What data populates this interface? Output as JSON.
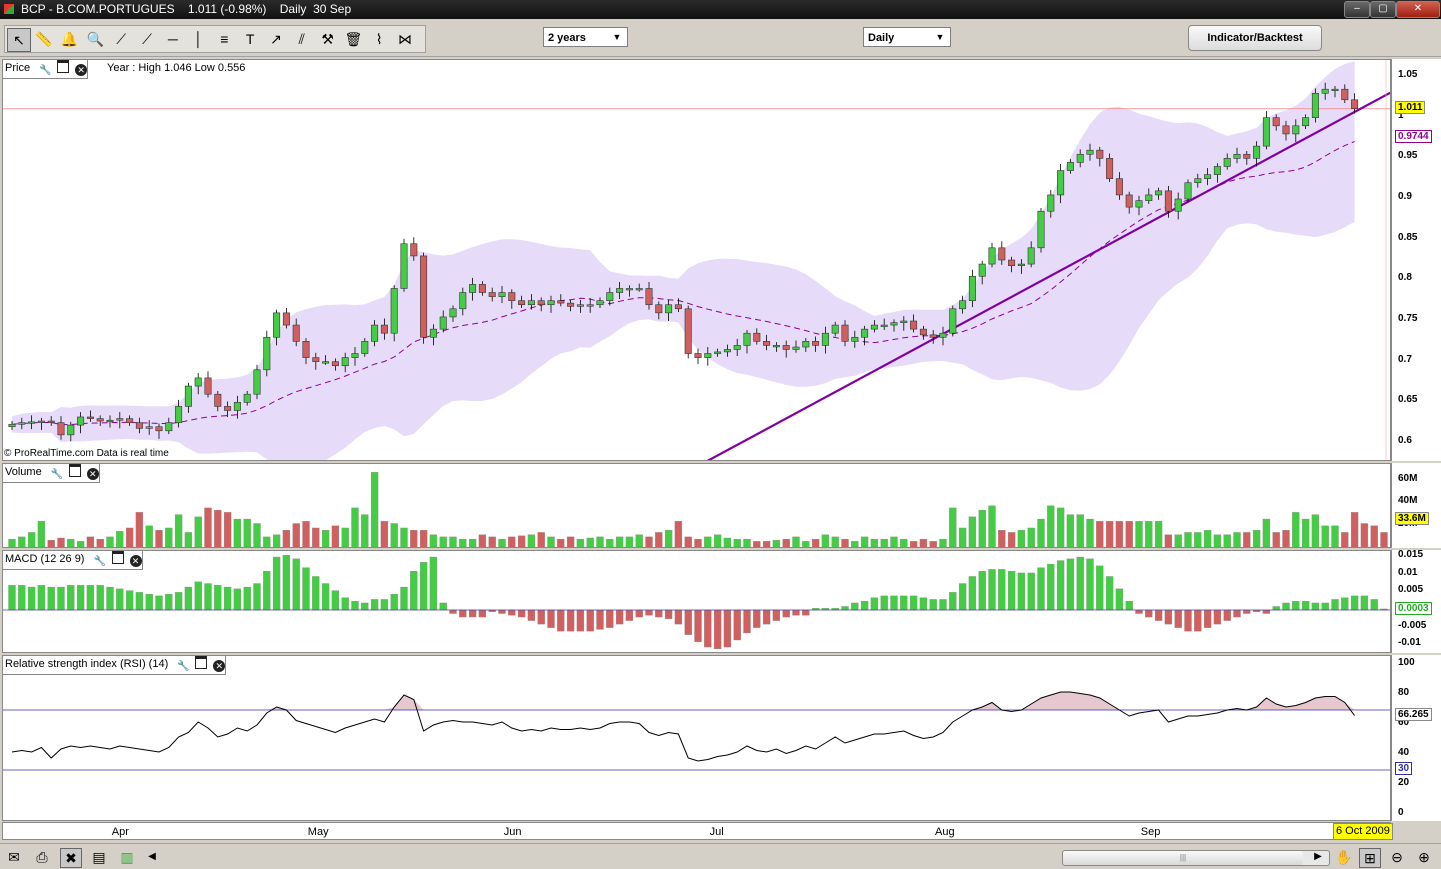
{
  "window": {
    "title": "BCP - B.COM.PORTUGUES    1.011 (-0.98%)    Daily  30 Sep",
    "minimize_label": "–",
    "maximize_label": "▢",
    "close_label": "✕"
  },
  "toolbar": {
    "tools": [
      "pointer-icon",
      "ruler-icon",
      "alert-bell-icon",
      "zoom-icon",
      "trendline-icon",
      "line-icon",
      "horizontal-line-icon",
      "vertical-line-icon",
      "fibonacci-icon",
      "text-icon",
      "arrow-icon",
      "channel-icon",
      "tools-icon",
      "trash-icon",
      "indicator-icon",
      "pattern-icon"
    ],
    "period_select": "2 years",
    "interval_select": "Daily",
    "indicator_button": "Indicator/Backtest"
  },
  "price_panel": {
    "title": "Price",
    "year_info": "Year : High 1.046 Low 0.556",
    "copyright": "© ProRealTime.com  Data is real time",
    "ticks": [
      "1.05",
      "1",
      "0.95",
      "0.9",
      "0.85",
      "0.8",
      "0.75",
      "0.7",
      "0.65",
      "0.6"
    ],
    "last_price_badge": "1.011",
    "ma_badge": "0.9744"
  },
  "volume_panel": {
    "title": "Volume",
    "ticks": [
      "60M",
      "40M",
      "20M"
    ],
    "badge": "33.6M"
  },
  "macd_panel": {
    "title": "MACD (12 26 9)",
    "ticks": [
      "0.015",
      "0.01",
      "0.005",
      "0",
      "-0.005",
      "-0.01"
    ],
    "badge": "0.0003"
  },
  "rsi_panel": {
    "title": "Relative strength index (RSI) (14)",
    "ticks": [
      "100",
      "80",
      "60",
      "40",
      "20",
      "0"
    ],
    "badge_value": "66.265",
    "badge_level": "30"
  },
  "x_axis": {
    "labels": [
      "Apr",
      "May",
      "Jun",
      "Jul",
      "Aug",
      "Sep"
    ],
    "date_badge": "6 Oct 2009"
  },
  "colors": {
    "up": "#44cc44",
    "down": "#d06060",
    "band": "#e6dcfa",
    "ma": "#900090",
    "trendline": "#8000a0"
  },
  "chart_data": {
    "type": "candlestick",
    "price_ylim": [
      0.58,
      1.06
    ],
    "close": [
      0.623,
      0.625,
      0.626,
      0.627,
      0.625,
      0.61,
      0.622,
      0.632,
      0.63,
      0.627,
      0.628,
      0.63,
      0.625,
      0.618,
      0.62,
      0.615,
      0.625,
      0.645,
      0.67,
      0.68,
      0.66,
      0.645,
      0.64,
      0.65,
      0.66,
      0.69,
      0.73,
      0.76,
      0.745,
      0.725,
      0.705,
      0.7,
      0.7,
      0.695,
      0.705,
      0.71,
      0.725,
      0.745,
      0.735,
      0.79,
      0.845,
      0.83,
      0.73,
      0.74,
      0.755,
      0.765,
      0.785,
      0.795,
      0.785,
      0.78,
      0.785,
      0.775,
      0.77,
      0.775,
      0.77,
      0.775,
      0.772,
      0.768,
      0.77,
      0.77,
      0.775,
      0.785,
      0.79,
      0.79,
      0.79,
      0.77,
      0.76,
      0.77,
      0.765,
      0.71,
      0.705,
      0.71,
      0.712,
      0.715,
      0.72,
      0.735,
      0.725,
      0.72,
      0.72,
      0.715,
      0.718,
      0.725,
      0.72,
      0.735,
      0.745,
      0.725,
      0.73,
      0.74,
      0.745,
      0.745,
      0.748,
      0.75,
      0.74,
      0.733,
      0.73,
      0.735,
      0.765,
      0.775,
      0.805,
      0.82,
      0.84,
      0.825,
      0.818,
      0.82,
      0.84,
      0.885,
      0.905,
      0.935,
      0.945,
      0.955,
      0.96,
      0.95,
      0.925,
      0.905,
      0.89,
      0.898,
      0.905,
      0.91,
      0.885,
      0.9,
      0.92,
      0.925,
      0.93,
      0.94,
      0.95,
      0.955,
      0.95,
      0.965,
      1.0,
      0.99,
      0.98,
      0.99,
      1.0,
      1.03,
      1.035,
      1.035,
      1.022,
      1.011
    ],
    "volume_m": [
      8,
      10,
      14,
      24,
      7,
      9,
      8,
      6,
      10,
      8,
      10,
      15,
      18,
      32,
      20,
      16,
      18,
      30,
      14,
      28,
      36,
      34,
      32,
      26,
      26,
      22,
      10,
      12,
      16,
      22,
      24,
      18,
      16,
      20,
      18,
      36,
      30,
      68,
      24,
      22,
      18,
      16,
      16,
      12,
      10,
      10,
      8,
      8,
      12,
      10,
      8,
      10,
      11,
      12,
      14,
      10,
      8,
      10,
      8,
      9,
      10,
      8,
      10,
      10,
      12,
      10,
      14,
      16,
      24,
      10,
      8,
      10,
      12,
      9,
      8,
      8,
      6,
      6,
      7,
      8,
      10,
      6,
      8,
      12,
      10,
      8,
      6,
      10,
      8,
      8,
      10,
      8,
      6,
      8,
      6,
      8,
      36,
      18,
      28,
      34,
      38,
      16,
      14,
      16,
      18,
      26,
      38,
      36,
      30,
      30,
      26,
      24,
      24,
      24,
      24,
      24,
      24,
      24,
      12,
      12,
      14,
      14,
      16,
      12,
      12,
      14,
      14,
      16,
      26,
      14,
      16,
      32,
      26,
      30,
      20,
      20,
      14,
      32,
      22,
      20,
      14,
      32,
      33.6
    ],
    "macd": [
      0.007,
      0.007,
      0.0065,
      0.007,
      0.0065,
      0.0065,
      0.007,
      0.007,
      0.007,
      0.007,
      0.0065,
      0.006,
      0.0055,
      0.005,
      0.0045,
      0.004,
      0.0045,
      0.005,
      0.0065,
      0.008,
      0.0075,
      0.007,
      0.0065,
      0.006,
      0.0065,
      0.0075,
      0.011,
      0.015,
      0.0155,
      0.0145,
      0.012,
      0.0095,
      0.0075,
      0.0055,
      0.0035,
      0.0025,
      0.002,
      0.003,
      0.003,
      0.0045,
      0.0065,
      0.011,
      0.0135,
      0.015,
      0.002,
      -0.001,
      -0.002,
      -0.002,
      -0.002,
      -0.0005,
      -0.001,
      -0.0015,
      -0.002,
      -0.003,
      -0.004,
      -0.005,
      -0.006,
      -0.006,
      -0.006,
      -0.006,
      -0.0055,
      -0.005,
      -0.004,
      -0.003,
      -0.002,
      -0.0015,
      -0.002,
      -0.0025,
      -0.004,
      -0.007,
      -0.009,
      -0.0105,
      -0.011,
      -0.0105,
      -0.0085,
      -0.0065,
      -0.005,
      -0.004,
      -0.003,
      -0.002,
      -0.0015,
      -0.0015,
      0.0005,
      0.0005,
      0.0005,
      0.001,
      0.002,
      0.0025,
      0.0035,
      0.004,
      0.004,
      0.004,
      0.004,
      0.0035,
      0.003,
      0.003,
      0.005,
      0.0075,
      0.0095,
      0.011,
      0.0115,
      0.0115,
      0.011,
      0.0105,
      0.0105,
      0.012,
      0.013,
      0.014,
      0.0145,
      0.015,
      0.0145,
      0.0125,
      0.0095,
      0.006,
      0.0025,
      -0.001,
      -0.002,
      -0.003,
      -0.004,
      -0.005,
      -0.006,
      -0.006,
      -0.005,
      -0.004,
      -0.003,
      -0.002,
      -0.001,
      -0.0005,
      -0.001,
      0.001,
      0.002,
      0.0025,
      0.0025,
      0.002,
      0.002,
      0.003,
      0.0035,
      0.004,
      0.004,
      0.003,
      0.0003
    ],
    "rsi": [
      42,
      43,
      42,
      45,
      38,
      44,
      46,
      45,
      46,
      45,
      44,
      46,
      45,
      44,
      43,
      42,
      45,
      52,
      55,
      62,
      58,
      52,
      54,
      58,
      56,
      60,
      68,
      72,
      70,
      63,
      61,
      59,
      57,
      55,
      58,
      60,
      62,
      64,
      62,
      72,
      80,
      77,
      56,
      60,
      62,
      63,
      62,
      62,
      61,
      60,
      62,
      58,
      56,
      57,
      56,
      58,
      57,
      57,
      58,
      57,
      58,
      61,
      62,
      62,
      61,
      55,
      53,
      55,
      54,
      38,
      36,
      37,
      39,
      40,
      42,
      46,
      43,
      42,
      44,
      41,
      43,
      46,
      44,
      48,
      52,
      48,
      50,
      52,
      54,
      54,
      55,
      56,
      53,
      51,
      52,
      55,
      62,
      66,
      70,
      72,
      75,
      70,
      69,
      70,
      74,
      78,
      80,
      82,
      82,
      81,
      80,
      78,
      74,
      70,
      66,
      68,
      69,
      70,
      62,
      64,
      66,
      66,
      67,
      68,
      70,
      71,
      70,
      72,
      78,
      74,
      72,
      73,
      75,
      78,
      79,
      79,
      75,
      66.265
    ],
    "rsi_levels": [
      70,
      30
    ],
    "trendline": {
      "from_index": 68,
      "from_value": 0.577,
      "to_index": 137,
      "to_value": 1.008
    }
  }
}
